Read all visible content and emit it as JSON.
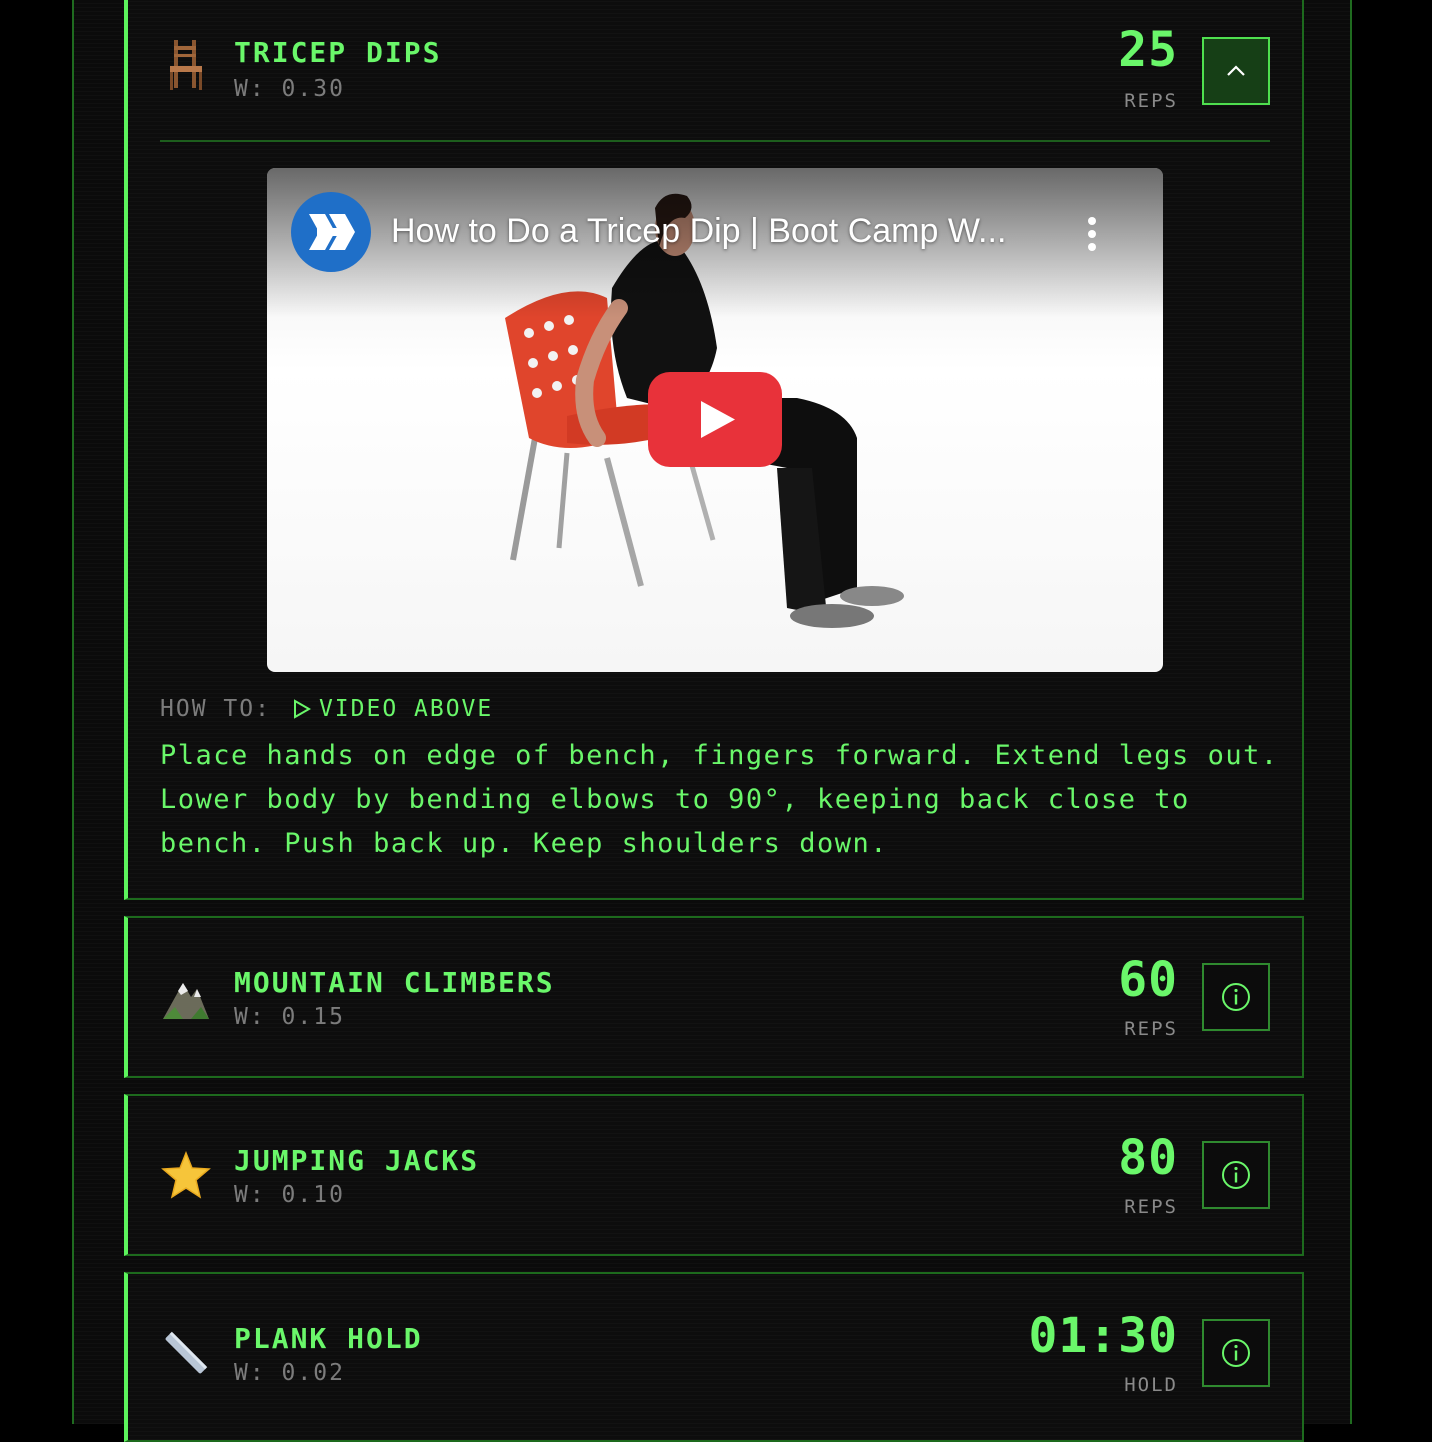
{
  "exercises": [
    {
      "name": "TRICEP DIPS",
      "weight": "W: 0.30",
      "count": "25",
      "unit": "REPS",
      "icon": "chair-icon",
      "expanded": true,
      "video": {
        "title": "How to Do a Tricep Dip | Boot Camp W...",
        "channel_icon": "channel-logo-icon"
      },
      "howto_label": "HOW TO:",
      "howto_link": "VIDEO ABOVE",
      "description": "Place hands on edge of bench, fingers forward. Extend legs out. Lower body by bending elbows to 90°, keeping back close to bench. Push back up. Keep shoulders down."
    },
    {
      "name": "MOUNTAIN CLIMBERS",
      "weight": "W: 0.15",
      "count": "60",
      "unit": "REPS",
      "icon": "mountain-icon"
    },
    {
      "name": "JUMPING JACKS",
      "weight": "W: 0.10",
      "count": "80",
      "unit": "REPS",
      "icon": "star-icon"
    },
    {
      "name": "PLANK HOLD",
      "weight": "W: 0.02",
      "count": "01:30",
      "unit": "HOLD",
      "icon": "plank-icon"
    }
  ],
  "colors": {
    "accent": "#6af76a",
    "muted": "#7c7c7c",
    "border": "#1d6a1d",
    "background": "#0b0b0b",
    "youtube_red": "#e8323a"
  }
}
